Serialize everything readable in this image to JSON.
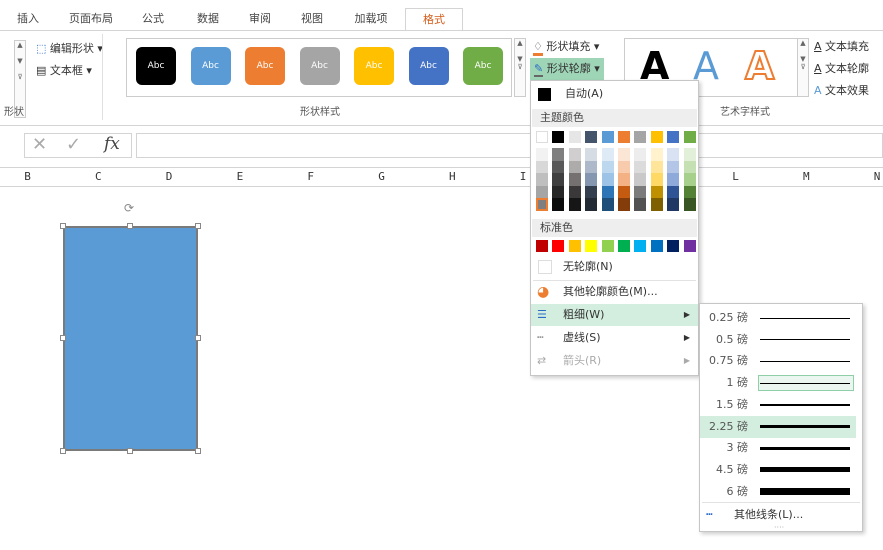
{
  "tabs": [
    "插入",
    "页面布局",
    "公式",
    "数据",
    "审阅",
    "视图",
    "加载项",
    "格式"
  ],
  "ribbon": {
    "edit_shape": "编辑形状",
    "text_box": "文本框",
    "group_shapes": "形状",
    "style_label": "Abc",
    "group_shape_styles": "形状样式",
    "shape_fill": "形状填充",
    "shape_outline": "形状轮廓",
    "wordart_letter": "A",
    "text_fill": "文本填充",
    "text_outline": "文本轮廓",
    "text_effects": "文本效果",
    "group_wordart": "艺术字样式",
    "style_colors": [
      "#000000",
      "#5b9bd5",
      "#ed7d31",
      "#a5a5a5",
      "#ffc000",
      "#4472c4",
      "#70ad47"
    ]
  },
  "formula_bar": {
    "cancel": "✕",
    "enter": "✓",
    "fx": "fx",
    "value": ""
  },
  "columns": [
    "B",
    "C",
    "D",
    "E",
    "F",
    "G",
    "H",
    "I",
    "",
    "",
    "L",
    "M",
    "N"
  ],
  "shape": {
    "fill": "#5b9bd5"
  },
  "outline_menu": {
    "auto": "自动(A)",
    "theme_colors": "主题颜色",
    "standard_colors": "标准色",
    "no_outline": "无轮廓(N)",
    "more_colors": "其他轮廓颜色(M)...",
    "weight": "粗细(W)",
    "dashes": "虚线(S)",
    "arrows": "箭头(R)",
    "theme_top": [
      "#ffffff",
      "#000000",
      "#e7e6e6",
      "#44546a",
      "#5b9bd5",
      "#ed7d31",
      "#a5a5a5",
      "#ffc000",
      "#4472c4",
      "#70ad47"
    ],
    "theme_shades": [
      [
        "#f2f2f2",
        "#d8d8d8",
        "#bfbfbf",
        "#a5a5a5",
        "#7f7f7f"
      ],
      [
        "#7f7f7f",
        "#595959",
        "#3f3f3f",
        "#262626",
        "#0c0c0c"
      ],
      [
        "#d0cece",
        "#aeabab",
        "#757171",
        "#3a3838",
        "#171616"
      ],
      [
        "#d6dce4",
        "#adb9ca",
        "#8496b0",
        "#333f4f",
        "#222a35"
      ],
      [
        "#deebf6",
        "#bdd7ee",
        "#9dc3e6",
        "#2e75b5",
        "#1f4e79"
      ],
      [
        "#fbe5d5",
        "#f7cbac",
        "#f4b183",
        "#c55a11",
        "#843c0b"
      ],
      [
        "#ededed",
        "#dbdbdb",
        "#c9c9c9",
        "#7b7b7b",
        "#525252"
      ],
      [
        "#fff2cc",
        "#fee599",
        "#ffd965",
        "#bf9000",
        "#7f6000"
      ],
      [
        "#d9e2f3",
        "#b4c6e7",
        "#8eaadb",
        "#2f5496",
        "#1f3864"
      ],
      [
        "#e2efd9",
        "#c5e0b3",
        "#a8d08d",
        "#538135",
        "#375623"
      ]
    ],
    "standard": [
      "#c00000",
      "#ff0000",
      "#ffc000",
      "#ffff00",
      "#92d050",
      "#00b050",
      "#00b0f0",
      "#0070c0",
      "#002060",
      "#7030a0"
    ]
  },
  "weight_menu": {
    "items": [
      {
        "label": "0.25 磅",
        "pt": 0.25
      },
      {
        "label": "0.5 磅",
        "pt": 0.5
      },
      {
        "label": "0.75 磅",
        "pt": 0.75
      },
      {
        "label": "1 磅",
        "pt": 1
      },
      {
        "label": "1.5 磅",
        "pt": 1.5
      },
      {
        "label": "2.25 磅",
        "pt": 2.25
      },
      {
        "label": "3 磅",
        "pt": 3
      },
      {
        "label": "4.5 磅",
        "pt": 4.5
      },
      {
        "label": "6 磅",
        "pt": 6
      }
    ],
    "hovered": "2.25 磅",
    "selected": "1 磅",
    "more_lines": "其他线条(L)..."
  },
  "accent": "#d35b18",
  "hover": "#d3eedf"
}
